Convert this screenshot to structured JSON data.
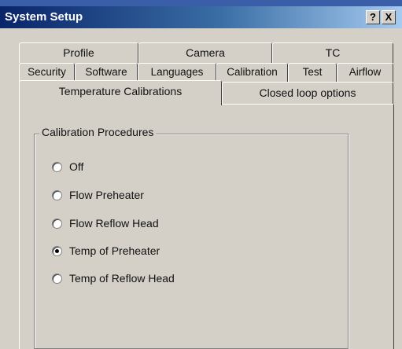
{
  "window": {
    "top_strip_text": "...",
    "title": "System Setup",
    "help_label": "?",
    "close_label": "X"
  },
  "tabs": {
    "row1": [
      "Profile",
      "Camera",
      "TC"
    ],
    "row2": [
      "Security",
      "Software",
      "Languages",
      "Calibration",
      "Test",
      "Airflow"
    ],
    "row3": [
      "Temperature Calibrations",
      "Closed loop options"
    ],
    "active": "Temperature Calibrations"
  },
  "group": {
    "legend": "Calibration Procedures",
    "options": [
      {
        "label": "Off",
        "checked": false
      },
      {
        "label": "Flow Preheater",
        "checked": false
      },
      {
        "label": "Flow Reflow Head",
        "checked": false
      },
      {
        "label": "Temp of Preheater",
        "checked": true
      },
      {
        "label": "Temp of Reflow Head",
        "checked": false
      }
    ]
  }
}
